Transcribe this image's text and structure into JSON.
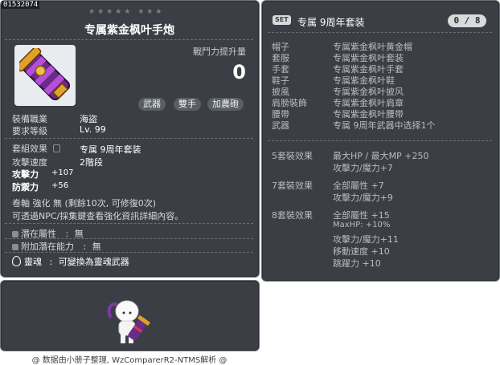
{
  "item": {
    "id_code": "01532074",
    "stars": "★★★★★  ★★★",
    "name": "专属紫金枫叶手炮",
    "combat_power_label": "戰鬥力提升量",
    "combat_power_value": "0",
    "tags": [
      "武器",
      "雙手",
      "加農砲"
    ],
    "job_label": "裝備職業",
    "job_value": "海盜",
    "req_level_label": "要求等級",
    "req_level_value": "Lv. 99",
    "set_effect_label": "套組效果",
    "set_effect_value": "专属 9周年套装",
    "attack_speed_label": "攻擊速度",
    "attack_speed_value": "2階段",
    "stats": [
      {
        "label": "攻擊力",
        "value": "+107"
      },
      {
        "label": "防禦力",
        "value": "+56"
      }
    ],
    "scroll_line": "卷軸 強化 無 (剩餘10次, 可修復0次)",
    "npc_line": "可透過NPC/採集鍵查看強化資訊詳細內容。",
    "potential_label": "潛在屬性",
    "potential_value": "無",
    "add_potential_label": "附加潛在能力",
    "add_potential_value": "無",
    "soul_label": "靈魂",
    "soul_value": "可變換為靈魂武器",
    "separator_colon": ":"
  },
  "set": {
    "badge": "SET",
    "name": "专属 9周年套装",
    "count": "0 / 8",
    "parts": [
      {
        "slot": "帽子",
        "item": "专属紫金枫叶黄金帽"
      },
      {
        "slot": "套服",
        "item": "专属紫金枫叶套装"
      },
      {
        "slot": "手套",
        "item": "专属紫金枫叶手套"
      },
      {
        "slot": "鞋子",
        "item": "专属紫金枫叶鞋"
      },
      {
        "slot": "披風",
        "item": "专属紫金枫叶披风"
      },
      {
        "slot": "肩膀裝飾",
        "item": "专属紫金枫叶肩章"
      },
      {
        "slot": "腰帶",
        "item": "专属紫金枫叶腰带"
      },
      {
        "slot": "武器",
        "item": "专属 9周年武器中选择1个"
      }
    ],
    "effects": [
      {
        "label": "5套裝效果",
        "lines": [
          "最大HP / 最大MP  +250",
          "攻擊力/魔力+7"
        ]
      },
      {
        "label": "7套裝效果",
        "lines": [
          "全部屬性 +7",
          "攻擊力/魔力+9"
        ]
      },
      {
        "label": "8套裝效果",
        "lines": [
          "全部屬性 +15",
          "MaxHP: +10%",
          "攻擊力/魔力+11",
          "移動速度 +10",
          "跳躍力 +10"
        ]
      }
    ]
  },
  "footer": "@ 数据由小册子整理, WzComparerR2-NTMS解析 @"
}
